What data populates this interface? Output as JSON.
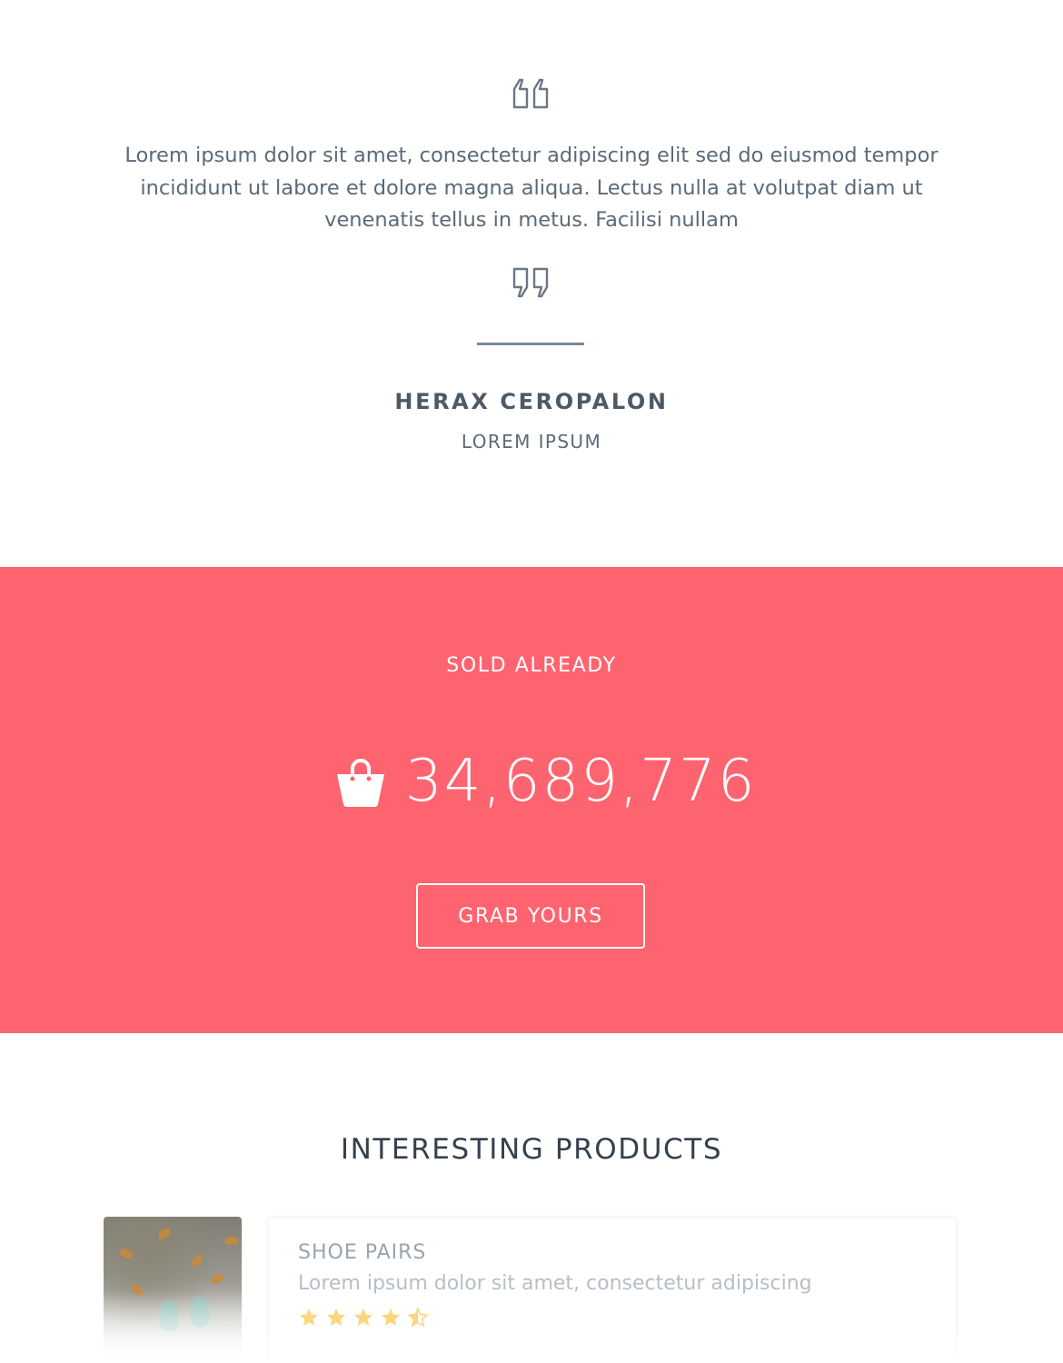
{
  "testimonial": {
    "quote": "Lorem ipsum dolor sit amet, consectetur adipiscing elit sed do eiusmod tempor incididunt ut labore et dolore magna aliqua. Lectus nulla at volutpat diam ut venenatis tellus in metus. Facilisi nullam",
    "author_name": "HERAX CEROPALON",
    "author_role": "LOREM IPSUM",
    "quote_icon_open": "quote-open-icon",
    "quote_icon_close": "quote-close-icon"
  },
  "sold": {
    "label": "SOLD ALREADY",
    "count": "34,689,776",
    "icon": "shopping-bag-icon",
    "button_label": "GRAB YOURS",
    "background_color": "#fe646f"
  },
  "products": {
    "title": "INTERESTING PRODUCTS",
    "items": [
      {
        "name": "SHOE PAIRS",
        "description": "Lorem ipsum dolor sit amet, consectetur adipiscing",
        "rating": 4.5,
        "rating_max": 5
      }
    ]
  },
  "colors": {
    "text": "#566573",
    "accent": "#fe646f",
    "star": "#f9d77e"
  }
}
